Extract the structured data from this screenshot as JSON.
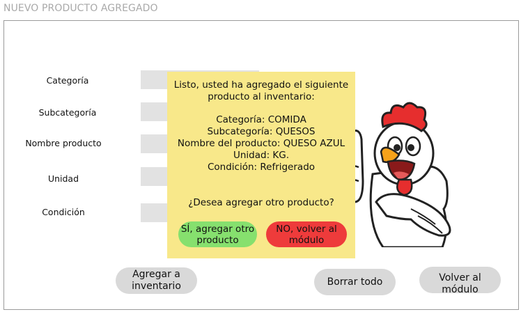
{
  "window": {
    "title": "NUEVO PRODUCTO AGREGADO"
  },
  "form": {
    "labels": [
      "Categoría",
      "Subcategoría",
      "Nombre producto",
      "Unidad",
      "Condición"
    ]
  },
  "actions": {
    "add": "Agregar a\ninventario",
    "clear": "Borrar todo",
    "back": "Volver al módulo"
  },
  "dialog": {
    "intro": "Listo, usted ha agregado el siguiente\nproducto al inventario:",
    "details": [
      "Categoría: COMIDA",
      "Subcategoría: QUESOS",
      "Nombre del producto: QUESO AZUL",
      "Unidad: KG.",
      "Condición: Refrigerado"
    ],
    "question": "¿Desea agregar otro producto?",
    "yes_label": "SÍ, agregar otro\nproducto",
    "no_label": "NO, volver al\nmódulo"
  },
  "colors": {
    "dialog_bg": "#f8e88a",
    "yes_button": "#86e06e",
    "no_button": "#ee3b3b",
    "field_bg": "#e2e2e2",
    "button_bg": "#d9d9d9"
  },
  "mascot": {
    "icon": "rooster-thumbs-up-icon"
  }
}
